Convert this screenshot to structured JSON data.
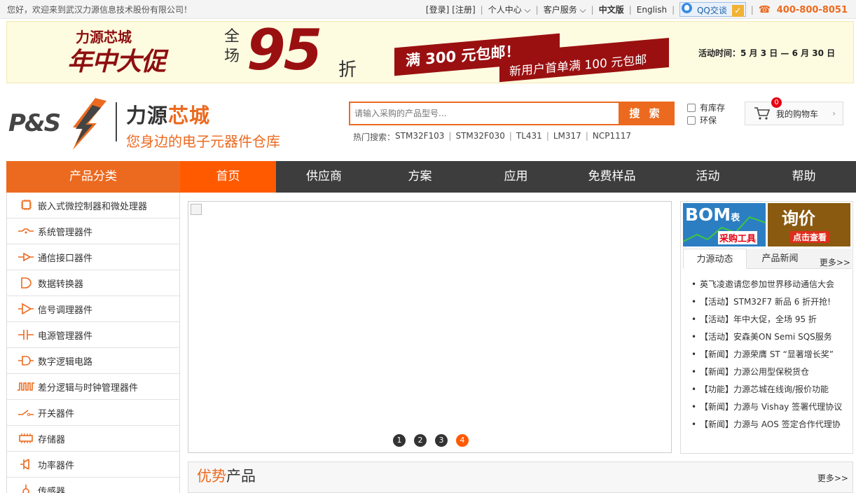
{
  "topbar": {
    "welcome": "您好，欢迎来到武汉力源信息技术股份有限公司！",
    "login": "[登录]",
    "register": "[注册]",
    "personal_center": "个人中心",
    "customer_service": "客户服务",
    "lang_cn": "中文版",
    "lang_en": "English",
    "qq_label": "QQ交谈",
    "phone": "400-800-8051"
  },
  "banner": {
    "brand": "力源芯城",
    "headline": "年中大促",
    "all_store": "全场",
    "discount_number": "95",
    "discount_unit": "折",
    "ribbon_line1": "满 300 元包邮！",
    "ribbon_line2": "新用户首单满 100 元包邮",
    "activity_time": "活动时间：5 月 3 日 — 6 月 30 日"
  },
  "header": {
    "logo_text": "P&S",
    "brand_prefix": "力源",
    "brand_highlight": "芯城",
    "slogan": "您身边的电子元器件仓库",
    "search_placeholder": "请输入采购的产品型号...",
    "search_button": "搜 索",
    "hot_label": "热门搜索：",
    "hot_items": [
      "STM32F103",
      "STM32F030",
      "TL431",
      "LM317",
      "NCP1117"
    ],
    "filter_in_stock": "有库存",
    "filter_eco": "环保",
    "cart_count": "0",
    "cart_label": "我的购物车"
  },
  "nav": {
    "category": "产品分类",
    "items": [
      "首页",
      "供应商",
      "方案",
      "应用",
      "免费样品",
      "活动",
      "帮助"
    ]
  },
  "sidebar": {
    "items": [
      {
        "label": "嵌入式微控制器和微处理器",
        "icon": "chip-icon"
      },
      {
        "label": "系统管理器件",
        "icon": "system-icon"
      },
      {
        "label": "通信接口器件",
        "icon": "interface-icon"
      },
      {
        "label": "数据转换器",
        "icon": "converter-icon"
      },
      {
        "label": "信号调理器件",
        "icon": "amplifier-icon"
      },
      {
        "label": "电源管理器件",
        "icon": "capacitor-icon"
      },
      {
        "label": "数字逻辑电路",
        "icon": "logic-gate-icon"
      },
      {
        "label": "差分逻辑与时钟管理器件",
        "icon": "clock-icon"
      },
      {
        "label": "开关器件",
        "icon": "switch-icon"
      },
      {
        "label": "存储器",
        "icon": "memory-icon"
      },
      {
        "label": "功率器件",
        "icon": "power-icon"
      },
      {
        "label": "传感器",
        "icon": "sensor-icon"
      }
    ]
  },
  "slider": {
    "dots": [
      "1",
      "2",
      "3",
      "4"
    ],
    "active_index": 3
  },
  "right_panel": {
    "promo_bom_title": "BOM",
    "promo_bom_suffix": "表",
    "promo_bom_sub": "采购工具",
    "promo_quote_title": "询价",
    "promo_quote_sub": "点击查看",
    "tab_news": "力源动态",
    "tab_product_news": "产品新闻",
    "more": "更多>>",
    "news": [
      "英飞凌邀请您参加世界移动通信大会",
      "【活动】STM32F7 新品 6 折开抢!",
      "【活动】年中大促，全场 95 折",
      "【活动】安森美ON Semi SQS服务",
      "【新闻】力源荣膺 ST “显著增长奖”",
      "【新闻】力源公用型保税货仓",
      "【功能】力源芯城在线询/报价功能",
      "【新闻】力源与 Vishay 签署代理协议",
      "【新闻】力源与 AOS 签定合作代理协"
    ]
  },
  "advantage": {
    "title_highlight": "优势",
    "title_rest": "产品",
    "more": "更多>>"
  },
  "colors": {
    "accent": "#ec6a1f",
    "nav_bg": "#3d3d3d",
    "active_nav": "#ff5a00",
    "banner_red": "#9a1011"
  }
}
